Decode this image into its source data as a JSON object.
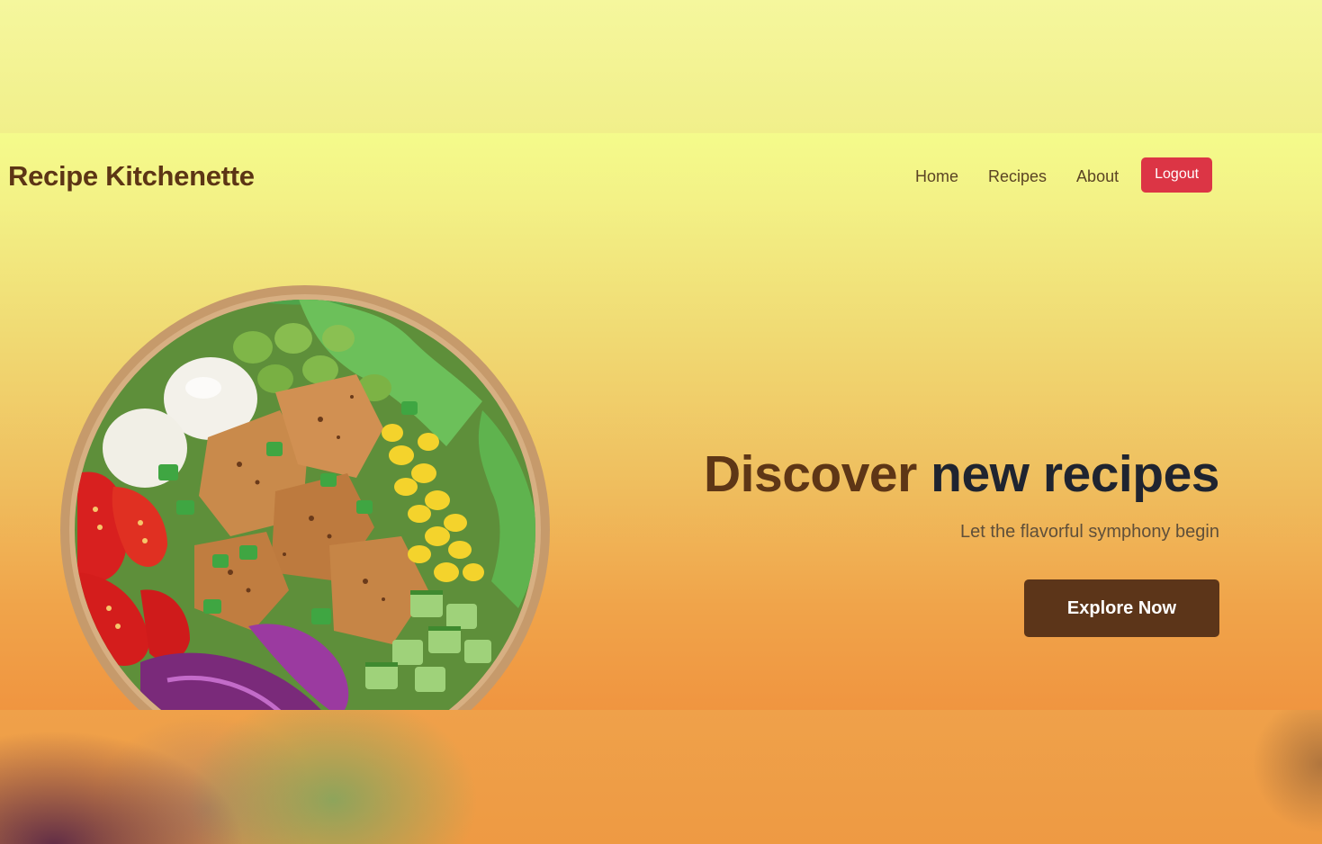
{
  "navbar": {
    "brand": "Recipe Kitchenette",
    "links": [
      {
        "label": "Home"
      },
      {
        "label": "Recipes"
      },
      {
        "label": "About"
      }
    ],
    "logout_label": "Logout"
  },
  "hero": {
    "title_accent": "Discover",
    "title_rest": "new recipes",
    "subtitle": "Let the flavorful symphony begin",
    "cta_label": "Explore Now",
    "image": "salad-bowl-image"
  },
  "colors": {
    "brand_brown": "#5c3515",
    "logout_red": "#dc3545",
    "cta_brown": "#5c3519",
    "title_dark": "#1f2430"
  }
}
